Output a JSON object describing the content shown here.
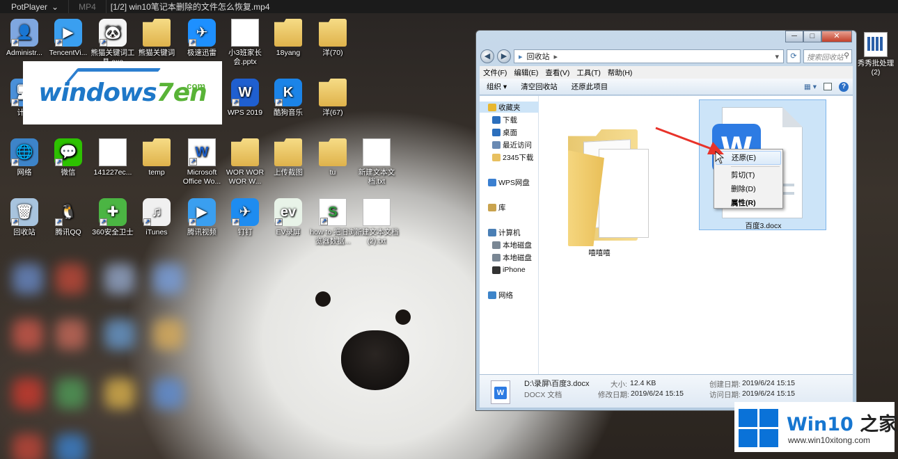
{
  "player": {
    "app_name": "PotPlayer",
    "format": "MP4",
    "title": "[1/2] win10笔记本删除的文件怎么恢复.mp4"
  },
  "desktop_icons": [
    {
      "label": "Administr...",
      "kind": "admin"
    },
    {
      "label": "TencentVi...",
      "kind": "tencentvideo"
    },
    {
      "label": "熊猫关键词工具.exe",
      "kind": "panda"
    },
    {
      "label": "熊猫关键词",
      "kind": "folder"
    },
    {
      "label": "极速迅雷",
      "kind": "xunlei"
    },
    {
      "label": "小3班家长会.pptx",
      "kind": "pptx"
    },
    {
      "label": "18yang",
      "kind": "folder"
    },
    {
      "label": "洋(70)",
      "kind": "folder"
    },
    {
      "label": "计算",
      "kind": "computer"
    },
    {
      "label": "WPS 2019",
      "kind": "wps"
    },
    {
      "label": "酷狗音乐",
      "kind": "kugou"
    },
    {
      "label": "洋(67)",
      "kind": "folder"
    },
    {
      "label": "网络",
      "kind": "network"
    },
    {
      "label": "微信",
      "kind": "wechat"
    },
    {
      "label": "141227ec...",
      "kind": "image"
    },
    {
      "label": "temp",
      "kind": "folder"
    },
    {
      "label": "Microsoft Office Wo...",
      "kind": "word"
    },
    {
      "label": "WOR WOR WOR W...",
      "kind": "folder"
    },
    {
      "label": "上传截图",
      "kind": "folder"
    },
    {
      "label": "tu",
      "kind": "folder"
    },
    {
      "label": "新建文本文档.txt",
      "kind": "txt"
    },
    {
      "label": "回收站",
      "kind": "recycle"
    },
    {
      "label": "腾讯QQ",
      "kind": "qq"
    },
    {
      "label": "360安全卫士",
      "kind": "360"
    },
    {
      "label": "iTunes",
      "kind": "itunes"
    },
    {
      "label": "腾讯视频",
      "kind": "tencentvideo"
    },
    {
      "label": "钉钉",
      "kind": "dingtalk"
    },
    {
      "label": "EV录屏",
      "kind": "ev"
    },
    {
      "label": "how to 把旧浏览器数据...",
      "kind": "sheet"
    },
    {
      "label": "新建文本文档(2).txt",
      "kind": "txt"
    }
  ],
  "right_edge_icon": {
    "label": "秀秀批处理 (2)"
  },
  "logo": {
    "text_part1": "windows",
    "text_part2": "7en",
    "domain": ".com"
  },
  "explorer": {
    "address": "回收站",
    "search_placeholder": "搜索回收站",
    "menu": [
      "文件(F)",
      "编辑(E)",
      "查看(V)",
      "工具(T)",
      "帮助(H)"
    ],
    "commands": [
      "组织 ▾",
      "清空回收站",
      "还原此项目"
    ],
    "nav": [
      {
        "label": "收藏夹",
        "icon": "star-icon"
      },
      {
        "label": "下载",
        "icon": "download-folder-icon"
      },
      {
        "label": "桌面",
        "icon": "desktop-icon"
      },
      {
        "label": "最近访问",
        "icon": "recent-icon"
      },
      {
        "label": "2345下载",
        "icon": "folder-icon"
      },
      {
        "label": "WPS网盘",
        "icon": "cloud-icon"
      },
      {
        "label": "库",
        "icon": "library-icon"
      },
      {
        "label": "计算机",
        "icon": "computer-icon"
      },
      {
        "label": "本地磁盘",
        "icon": "disk-icon"
      },
      {
        "label": "本地磁盘",
        "icon": "disk-icon"
      },
      {
        "label": "iPhone",
        "icon": "phone-icon"
      },
      {
        "label": "网络",
        "icon": "network-icon"
      }
    ],
    "files": [
      {
        "name": "嘻嘻嘻",
        "kind": "folder"
      },
      {
        "name": "百度3.docx",
        "kind": "docx",
        "selected": true
      }
    ],
    "context_menu": [
      {
        "label": "还原(E)",
        "highlighted": true
      },
      {
        "label": "剪切(T)"
      },
      {
        "label": "删除(D)"
      },
      {
        "label": "属性(R)",
        "bold": true
      }
    ],
    "details": {
      "path": "D:\\录屏\\百度3.docx",
      "type": "DOCX 文档",
      "size_label": "大小:",
      "size": "12.4 KB",
      "modified_label": "修改日期:",
      "modified": "2019/6/24 15:15",
      "created_label": "创建日期:",
      "created": "2019/6/24 15:15",
      "accessed_label": "访问日期:",
      "accessed": "2019/6/24 15:15"
    }
  },
  "badge": {
    "name_part1": "Win10",
    "name_part2": " 之家",
    "url": "www.win10xitong.com"
  },
  "colors": {
    "explorer_frame": "#c7d9ea",
    "selection": "#cce4f8",
    "arrow": "#e8332a",
    "badge_blue": "#0a72d8"
  }
}
